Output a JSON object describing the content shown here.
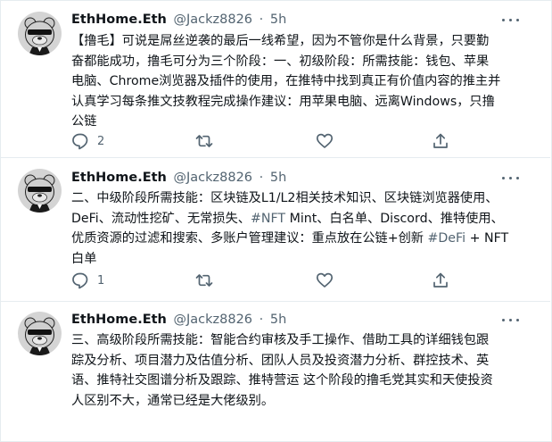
{
  "colors": {
    "text": "#0f1419",
    "muted": "#536471",
    "border": "#e6ecf0"
  },
  "icons": {
    "more": "more-icon",
    "reply": "reply-icon",
    "retweet": "retweet-icon",
    "like": "like-icon",
    "share": "share-icon"
  },
  "tweets": [
    {
      "display_name": "EthHome.Eth",
      "handle": "@Jackz8826",
      "separator": "·",
      "time": "5h",
      "lines": [
        "【撸毛】可说是屌丝逆袭的最后一线希望，因为不管你是什么背景，只要勤",
        "奋都能成功，撸毛可分为三个阶段：一、初级阶段：所需技能：钱包、苹果",
        "电脑、Chrome浏览器及插件的使用，在推特中找到真正有价值内容的推主并",
        "认真学习每条推文技教程完成操作建议：用苹果电脑、远离Windows，只撸",
        "公链"
      ],
      "reply_count": "2"
    },
    {
      "display_name": "EthHome.Eth",
      "handle": "@Jackz8826",
      "separator": "·",
      "time": "5h",
      "lines": [
        "二、中级阶段所需技能：区块链及L1/L2相关技术知识、区块链浏览器使用、",
        "DeFi、流动性挖矿、无常损失、",
        "优质资源的过滤和搜索、多账户管理建议：重点放在公链+创新 ",
        "白单"
      ],
      "line2_hashtag": "#NFT",
      "line2_tail": " Mint、白名单、Discord、推特使用、",
      "line3_hashtag": "#DeFi",
      "line3_tail": " + NFT",
      "reply_count": "1"
    },
    {
      "display_name": "EthHome.Eth",
      "handle": "@Jackz8826",
      "separator": "·",
      "time": "5h",
      "lines": [
        "三、高级阶段所需技能：智能合约审核及手工操作、借助工具的详细钱包跟",
        "踪及分析、项目潜力及估值分析、团队人员及投资潜力分析、群控技术、英",
        "语、推特社交图谱分析及跟踪、推特营运 这个阶段的撸毛党其实和天使投资",
        "人区别不大，通常已经是大佬级别。"
      ]
    }
  ]
}
